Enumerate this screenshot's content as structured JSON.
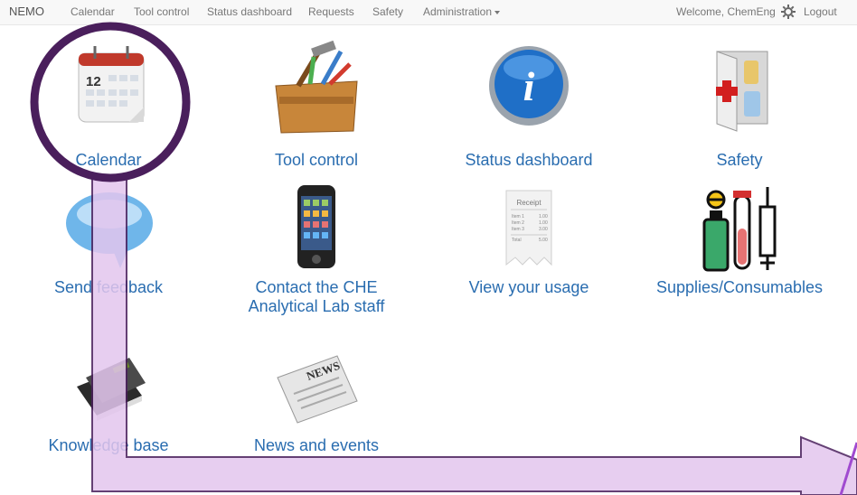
{
  "navbar": {
    "brand": "NEMO",
    "items": [
      {
        "label": "Calendar"
      },
      {
        "label": "Tool control"
      },
      {
        "label": "Status dashboard"
      },
      {
        "label": "Requests"
      },
      {
        "label": "Safety"
      },
      {
        "label": "Administration"
      }
    ],
    "welcome": "Welcome, ChemEng",
    "logout": "Logout"
  },
  "tiles": [
    {
      "label": "Calendar",
      "icon": "calendar-icon",
      "calendar_day": "12"
    },
    {
      "label": "Tool control",
      "icon": "toolbox-icon"
    },
    {
      "label": "Status dashboard",
      "icon": "info-icon",
      "info_letter": "i"
    },
    {
      "label": "Safety",
      "icon": "first-aid-cabinet-icon"
    },
    {
      "label": "Send feedback",
      "icon": "speech-bubble-icon"
    },
    {
      "label": "Contact the CHE\nAnalytical Lab staff",
      "icon": "phone-icon"
    },
    {
      "label": "View your usage",
      "icon": "receipt-icon",
      "receipt": {
        "title": "Receipt",
        "rows": [
          [
            "Item 1",
            "1.00"
          ],
          [
            "Item 2",
            "1.00"
          ],
          [
            "Item 3",
            "3.00"
          ]
        ],
        "total": [
          "Total",
          "5.00"
        ]
      }
    },
    {
      "label": "Supplies/Consumables",
      "icon": "lab-supplies-icon"
    },
    {
      "label": "Knowledge base",
      "icon": "books-icon"
    },
    {
      "label": "News and events",
      "icon": "newspaper-icon",
      "news_word": "NEWS"
    }
  ],
  "colors": {
    "link": "#2a6db0",
    "annotation_stroke": "#4a1f5c",
    "annotation_fill": "#e3c6ee"
  }
}
